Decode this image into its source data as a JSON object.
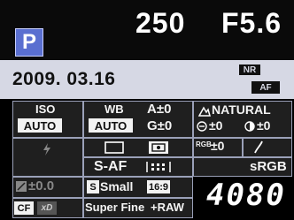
{
  "header": {
    "mode": "P",
    "shutter_speed": "250",
    "aperture": "F5.6"
  },
  "date_bar": {
    "date": "2009. 03.16",
    "noise_reduction_badge": "NR",
    "af_badge": "AF"
  },
  "settings": {
    "iso_label": "ISO",
    "iso_value": "AUTO",
    "wb_label": "WB",
    "wb_value": "AUTO",
    "wb_a_adjust": "A±0",
    "wb_g_adjust": "G±0",
    "picture_mode": "NATURAL",
    "sharpness": "±0",
    "contrast": "±0",
    "saturation": "±0",
    "af_mode": "S-AF",
    "color_space": "sRGB",
    "exposure_comp": "±0.0",
    "image_size": "Small",
    "aspect": "16:9",
    "quality": "Super Fine",
    "raw_label": "+RAW",
    "card": "CF",
    "card_alt": "xD",
    "shots_remaining": "4080"
  }
}
